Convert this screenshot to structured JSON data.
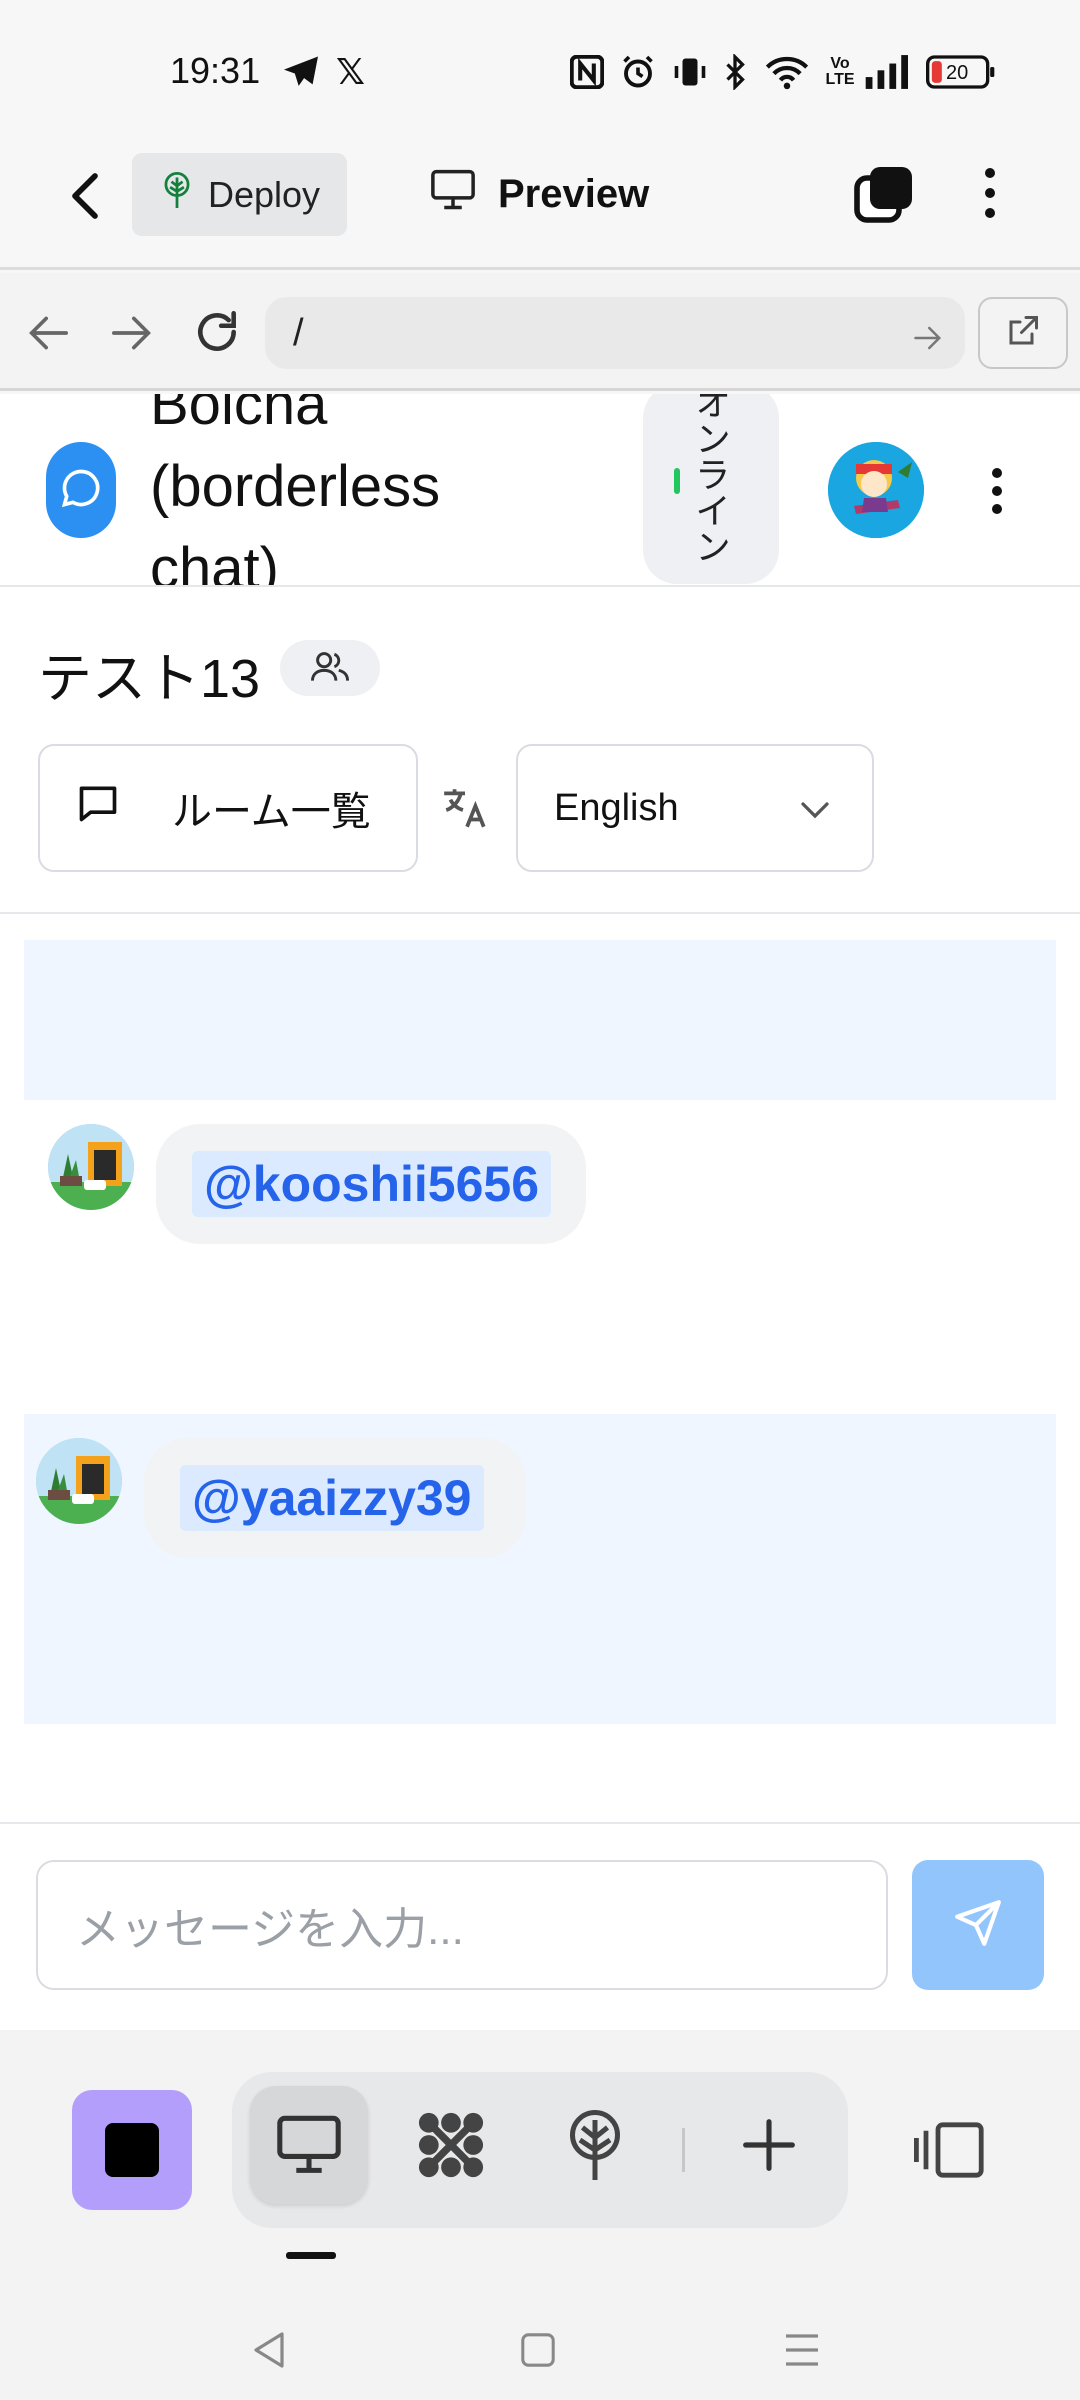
{
  "status_bar": {
    "time": "19:31",
    "battery": "20",
    "volte": "Vo LTE"
  },
  "toolbar": {
    "deploy_label": "Deploy",
    "preview_label": "Preview"
  },
  "browser": {
    "url": "/"
  },
  "app": {
    "title": "Bolcha (borderless chat)",
    "online_label": "オンライン",
    "room_title": "テスト13",
    "rooms_button_label": "ルーム一覧",
    "language_selected": "English",
    "messages": [
      {
        "mention": "@kooshii5656"
      },
      {
        "mention": "@yaaizzy39"
      }
    ],
    "input_placeholder": "メッセージを入力..."
  },
  "colors": {
    "accent_blue": "#2b90f2",
    "mention_text": "#2563eb",
    "mention_bg": "#dbeafe",
    "highlight_band": "#eff6ff",
    "send_button": "#93c5fd",
    "online_dot": "#22c55e",
    "dock_active_app": "#b39ffb"
  },
  "icons": {
    "toolbar": [
      "back-arrow-icon",
      "deploy-tree-icon",
      "monitor-icon",
      "tabs-icon",
      "more-vertical-icon"
    ],
    "browser": [
      "back-icon",
      "forward-icon",
      "reload-icon",
      "go-arrow-icon",
      "open-external-icon"
    ],
    "app": [
      "chat-bubble-icon",
      "users-icon",
      "message-square-icon",
      "translate-icon",
      "chevron-down-icon",
      "send-icon"
    ],
    "dock": [
      "stop-icon",
      "monitor-icon",
      "workflow-icon",
      "deploy-icon",
      "plus-icon",
      "side-panel-icon"
    ],
    "nav": [
      "nav-back-icon",
      "nav-home-icon",
      "nav-menu-icon"
    ]
  }
}
